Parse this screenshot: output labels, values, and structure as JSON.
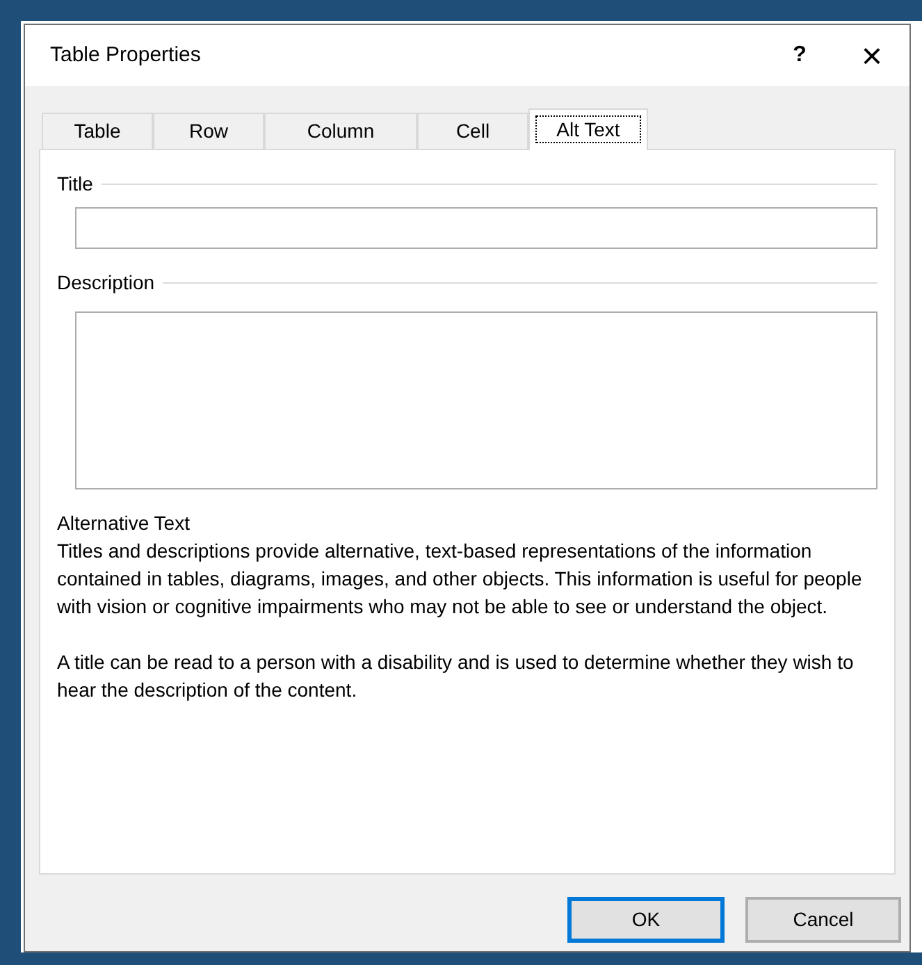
{
  "window": {
    "title": "Table Properties",
    "help": "?",
    "close": "×"
  },
  "tabs": [
    {
      "label": "Table",
      "selected": false
    },
    {
      "label": "Row",
      "selected": false
    },
    {
      "label": "Column",
      "selected": false
    },
    {
      "label": "Cell",
      "selected": false
    },
    {
      "label": "Alt Text",
      "selected": true
    }
  ],
  "title_section": {
    "label": "Title"
  },
  "description_section": {
    "label": "Description"
  },
  "alt_text_info": {
    "heading": "Alternative Text",
    "paragraphs": [
      "Titles and descriptions provide alternative, text-based representations of the information contained in tables, diagrams, images, and other objects. This information is useful for people with vision or cognitive impairments who may not be able to see or understand the object.",
      "A title can be read to a person with a disability and is used to determine whether they wish to hear the description of the content."
    ]
  },
  "buttons": [
    {
      "label": "OK",
      "default": true
    },
    {
      "label": "Cancel",
      "default": false
    }
  ]
}
